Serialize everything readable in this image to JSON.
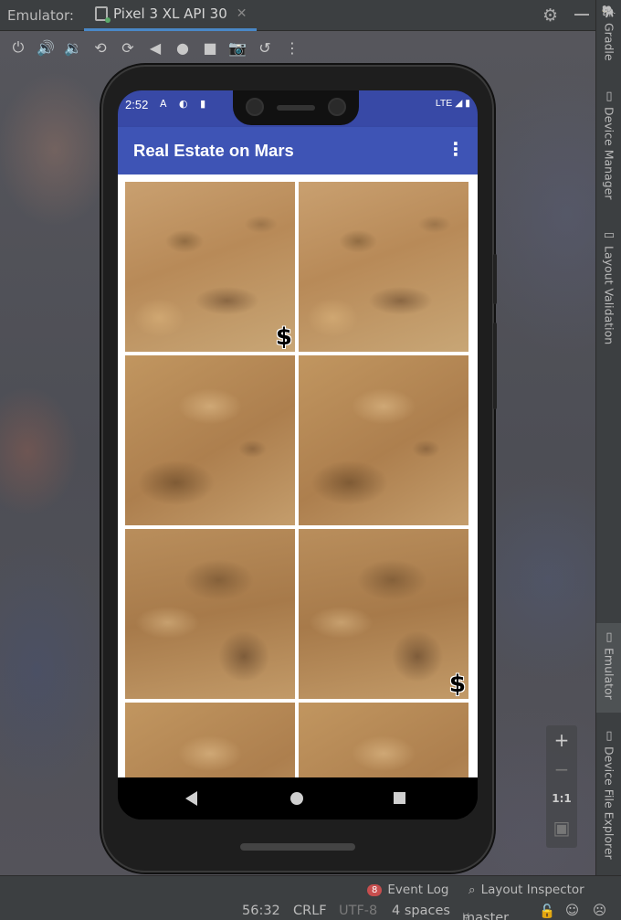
{
  "ide": {
    "panel_label": "Emulator:",
    "device_tab": "Pixel 3 XL API 30",
    "close_glyph": "✕",
    "settings_glyph": "⚙",
    "controls": [
      {
        "name": "power-icon",
        "glyph": "⏻"
      },
      {
        "name": "volume-up-icon",
        "glyph": "🔊"
      },
      {
        "name": "volume-down-icon",
        "glyph": "🔉"
      },
      {
        "name": "rotate-left-icon",
        "glyph": "⟲"
      },
      {
        "name": "rotate-right-icon",
        "glyph": "⟳"
      },
      {
        "name": "back-icon",
        "glyph": "◀"
      },
      {
        "name": "home-icon",
        "glyph": "●"
      },
      {
        "name": "overview-icon",
        "glyph": "■"
      },
      {
        "name": "camera-icon",
        "glyph": "📷"
      },
      {
        "name": "snapshot-icon",
        "glyph": "↺"
      },
      {
        "name": "more-icon",
        "glyph": "⋮"
      }
    ],
    "right_tabs": [
      "Gradle",
      "Device Manager",
      "Layout Validation",
      "Emulator",
      "Device File Explorer"
    ],
    "zoom": {
      "plus": "+",
      "minus": "−",
      "ratio": "1:1"
    },
    "status": {
      "event_count": "8",
      "event_log": "Event Log",
      "layout_inspector": "Layout Inspector",
      "position": "56:32",
      "line_sep": "CRLF",
      "encoding": "UTF-8",
      "indent": "4 spaces",
      "branch": "master"
    }
  },
  "device": {
    "time": "2:52",
    "status_icons": "A ◐ ▮",
    "network": "LTE ◢ ▮",
    "app_title": "Real Estate on Mars",
    "overflow_glyph": "⋮",
    "tiles": [
      {
        "variant": "v1",
        "badge": "$"
      },
      {
        "variant": "v1",
        "badge": ""
      },
      {
        "variant": "v2",
        "badge": ""
      },
      {
        "variant": "v2",
        "badge": ""
      },
      {
        "variant": "v3",
        "badge": ""
      },
      {
        "variant": "v3",
        "badge": "$"
      },
      {
        "variant": "v2",
        "badge": ""
      },
      {
        "variant": "v2",
        "badge": ""
      }
    ]
  }
}
